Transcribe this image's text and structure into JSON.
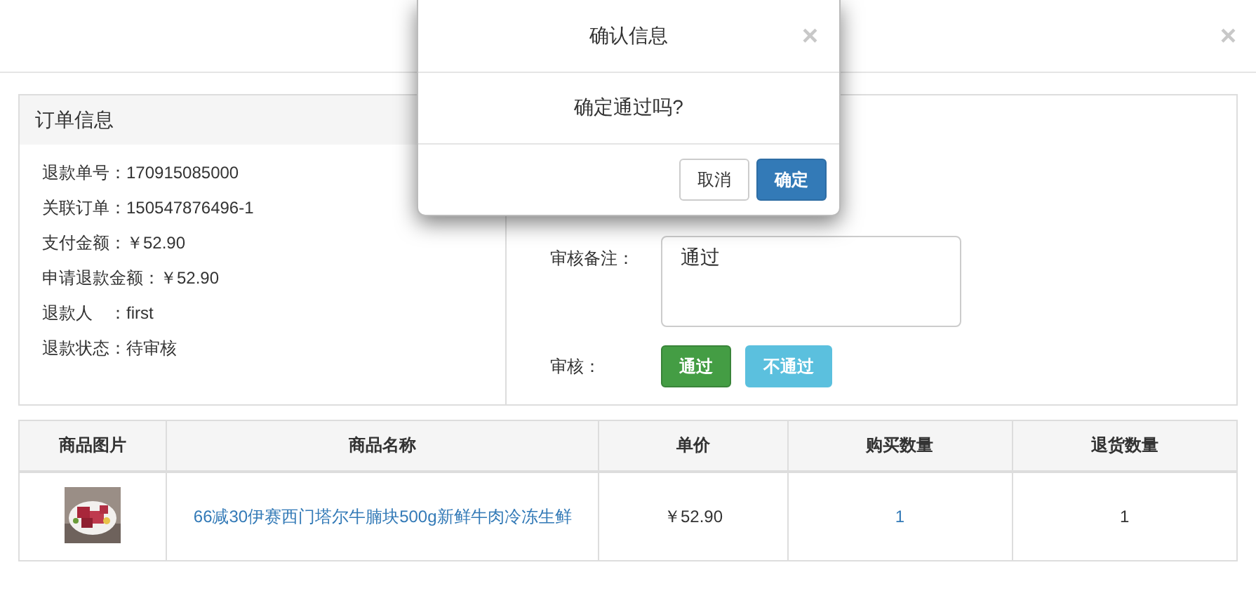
{
  "page_modal": {
    "close": "×"
  },
  "order_panel": {
    "title": "订单信息",
    "fields": [
      {
        "label": "退款单号：",
        "value": "170915085000"
      },
      {
        "label": "关联订单：",
        "value": "150547876496-1"
      },
      {
        "label": "支付金额：",
        "value": "￥52.90"
      },
      {
        "label": "申请退款金额：",
        "value": "￥52.90"
      },
      {
        "label": "退款人　：",
        "value": "first"
      },
      {
        "label": "退款状态：",
        "value": "待审核"
      }
    ]
  },
  "review": {
    "remark_label": "审核备注：",
    "remark_value": "通过",
    "decision_label": "审核：",
    "buttons": [
      {
        "label": "通过",
        "kind": "success"
      },
      {
        "label": "不通过",
        "kind": "info"
      }
    ]
  },
  "table": {
    "columns": [
      "商品图片",
      "商品名称",
      "单价",
      "购买数量",
      "退货数量"
    ],
    "rows": [
      {
        "name": "66减30伊赛西门塔尔牛腩块500g新鲜牛肉冷冻生鲜",
        "price": "￥52.90",
        "bought": "1",
        "returned": "1"
      }
    ]
  },
  "dialog": {
    "title": "确认信息",
    "close": "×",
    "message": "确定通过吗?",
    "buttons": [
      {
        "label": "取消",
        "kind": "default"
      },
      {
        "label": "确定",
        "kind": "primary"
      }
    ]
  }
}
